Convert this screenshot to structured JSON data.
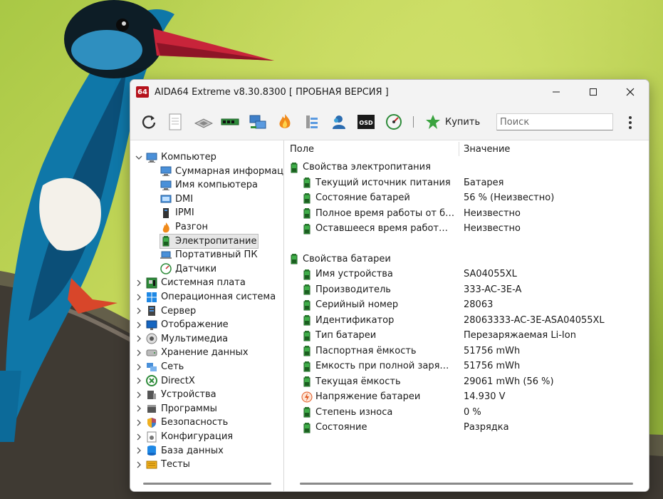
{
  "window": {
    "title": "AIDA64 Extreme v8.30.8300  [ ПРОБНАЯ ВЕРСИЯ ]",
    "logo_text": "64"
  },
  "toolbar": {
    "buy_label": "Купить",
    "search_placeholder": "Поиск"
  },
  "tree": {
    "items": [
      {
        "label": "Компьютер",
        "icon": "computer-icon",
        "level": 0,
        "expanded": true
      },
      {
        "label": "Суммарная информация",
        "icon": "summary-icon",
        "level": 1
      },
      {
        "label": "Имя компьютера",
        "icon": "computer-name-icon",
        "level": 1
      },
      {
        "label": "DMI",
        "icon": "dmi-icon",
        "level": 1
      },
      {
        "label": "IPMI",
        "icon": "ipmi-icon",
        "level": 1
      },
      {
        "label": "Разгон",
        "icon": "flame-icon",
        "level": 1
      },
      {
        "label": "Электропитание",
        "icon": "battery-icon",
        "level": 1,
        "selected": true
      },
      {
        "label": "Портативный ПК",
        "icon": "laptop-icon",
        "level": 1
      },
      {
        "label": "Датчики",
        "icon": "gauge-icon",
        "level": 1
      },
      {
        "label": "Системная плата",
        "icon": "motherboard-icon",
        "level": 0
      },
      {
        "label": "Операционная система",
        "icon": "windows-icon",
        "level": 0
      },
      {
        "label": "Сервер",
        "icon": "server-icon",
        "level": 0
      },
      {
        "label": "Отображение",
        "icon": "display-icon",
        "level": 0
      },
      {
        "label": "Мультимедиа",
        "icon": "speaker-icon",
        "level": 0
      },
      {
        "label": "Хранение данных",
        "icon": "storage-icon",
        "level": 0
      },
      {
        "label": "Сеть",
        "icon": "network-icon",
        "level": 0
      },
      {
        "label": "DirectX",
        "icon": "directx-icon",
        "level": 0
      },
      {
        "label": "Устройства",
        "icon": "devices-icon",
        "level": 0
      },
      {
        "label": "Программы",
        "icon": "programs-icon",
        "level": 0
      },
      {
        "label": "Безопасность",
        "icon": "shield-icon",
        "level": 0
      },
      {
        "label": "Конфигурация",
        "icon": "config-icon",
        "level": 0
      },
      {
        "label": "База данных",
        "icon": "database-icon",
        "level": 0
      },
      {
        "label": "Тесты",
        "icon": "tests-icon",
        "level": 0
      }
    ]
  },
  "details": {
    "col_field": "Поле",
    "col_value": "Значение",
    "groups": [
      {
        "title": "Свойства электропитания",
        "rows": [
          {
            "field": "Текущий источник питания",
            "value": "Батарея",
            "icon": "battery-icon"
          },
          {
            "field": "Состояние батарей",
            "value": "56 % (Неизвестно)",
            "icon": "battery-icon"
          },
          {
            "field": "Полное время работы от батареи",
            "value": "Неизвестно",
            "icon": "battery-icon"
          },
          {
            "field": "Оставшееся время работы от батареи",
            "value": "Неизвестно",
            "icon": "battery-icon"
          }
        ]
      },
      {
        "title": "Свойства батареи",
        "rows": [
          {
            "field": "Имя устройства",
            "value": "SA04055XL",
            "icon": "battery-icon"
          },
          {
            "field": "Производитель",
            "value": "333-AC-3E-A",
            "icon": "battery-icon"
          },
          {
            "field": "Серийный номер",
            "value": "28063",
            "icon": "battery-icon"
          },
          {
            "field": "Идентификатор",
            "value": "28063333-AC-3E-ASA04055XL",
            "icon": "battery-icon"
          },
          {
            "field": "Тип батареи",
            "value": "Перезаряжаемая Li-Ion",
            "icon": "battery-icon"
          },
          {
            "field": "Паспортная ёмкость",
            "value": "51756 mWh",
            "icon": "battery-icon"
          },
          {
            "field": "Ёмкость при полной зарядке",
            "value": "51756 mWh",
            "icon": "battery-icon"
          },
          {
            "field": "Текущая ёмкость",
            "value": "29061 mWh  (56 %)",
            "icon": "battery-icon"
          },
          {
            "field": "Напряжение батареи",
            "value": "14.930 V",
            "icon": "voltage-icon"
          },
          {
            "field": "Степень износа",
            "value": "0 %",
            "icon": "battery-icon"
          },
          {
            "field": "Состояние",
            "value": "Разрядка",
            "icon": "battery-icon"
          }
        ]
      }
    ]
  }
}
